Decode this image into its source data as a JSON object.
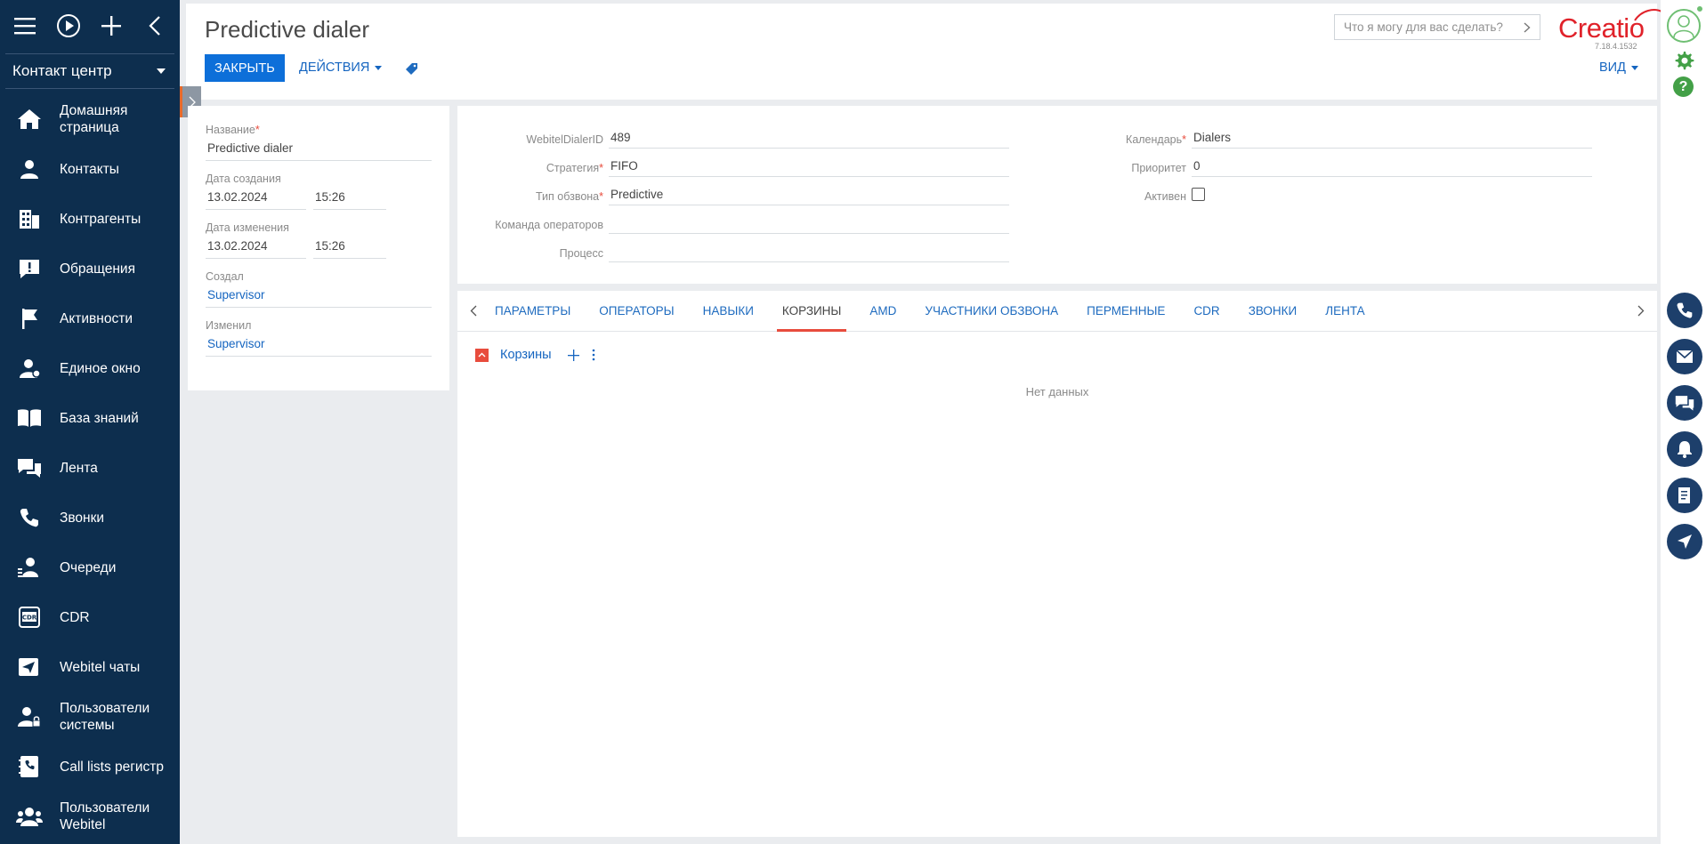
{
  "sidebar": {
    "workspace": "Контакт центр",
    "items": [
      {
        "label": "Домашняя страница",
        "icon": "home-icon"
      },
      {
        "label": "Контакты",
        "icon": "person-icon"
      },
      {
        "label": "Контрагенты",
        "icon": "building-icon"
      },
      {
        "label": "Обращения",
        "icon": "exclamation-chat-icon"
      },
      {
        "label": "Активности",
        "icon": "flag-icon"
      },
      {
        "label": "Единое окно",
        "icon": "operator-icon"
      },
      {
        "label": "База знаний",
        "icon": "book-icon"
      },
      {
        "label": "Лента",
        "icon": "chat-icon"
      },
      {
        "label": "Звонки",
        "icon": "phone-icon"
      },
      {
        "label": "Очереди",
        "icon": "queue-icon"
      },
      {
        "label": "CDR",
        "icon": "cdr-icon"
      },
      {
        "label": "Webitel чаты",
        "icon": "send-icon"
      },
      {
        "label": "Пользователи системы",
        "icon": "user-lock-icon"
      },
      {
        "label": "Call lists регистр",
        "icon": "phonebook-icon"
      },
      {
        "label": "Пользователи Webitel",
        "icon": "users-icon"
      }
    ]
  },
  "header": {
    "title": "Predictive dialer",
    "close_label": "ЗАКРЫТЬ",
    "actions_label": "ДЕЙСТВИЯ",
    "view_label": "ВИД",
    "search_placeholder": "Что я могу для вас сделать?",
    "logo": "Creatio",
    "version": "7.18.4.1532"
  },
  "left_panel": {
    "name_label": "Название",
    "name_value": "Predictive dialer",
    "created_label": "Дата создания",
    "created_date": "13.02.2024",
    "created_time": "15:26",
    "modified_label": "Дата изменения",
    "modified_date": "13.02.2024",
    "modified_time": "15:26",
    "created_by_label": "Создал",
    "created_by": "Supervisor",
    "modified_by_label": "Изменил",
    "modified_by": "Supervisor"
  },
  "fields": {
    "dialer_id_label": "WebitelDialerID",
    "dialer_id": "489",
    "strategy_label": "Стратегия",
    "strategy": "FIFO",
    "dial_type_label": "Тип обзвона",
    "dial_type": "Predictive",
    "team_label": "Команда операторов",
    "team": "",
    "process_label": "Процесс",
    "process": "",
    "calendar_label": "Календарь",
    "calendar": "Dialers",
    "priority_label": "Приоритет",
    "priority": "0",
    "active_label": "Активен"
  },
  "tabs": [
    "ПАРАМЕТРЫ",
    "ОПЕРАТОРЫ",
    "НАВЫКИ",
    "КОРЗИНЫ",
    "AMD",
    "УЧАСТНИКИ ОБЗВОНА",
    "ПЕРМЕННЫЕ",
    "CDR",
    "ЗВОНКИ",
    "ЛЕНТА"
  ],
  "detail": {
    "title": "Корзины",
    "empty": "Нет данных"
  },
  "colors": {
    "sidebar": "#0d2e4e",
    "primary": "#0d6fd9",
    "link": "#1565c0",
    "accent": "#e84c3d",
    "gear": "#43a047"
  }
}
